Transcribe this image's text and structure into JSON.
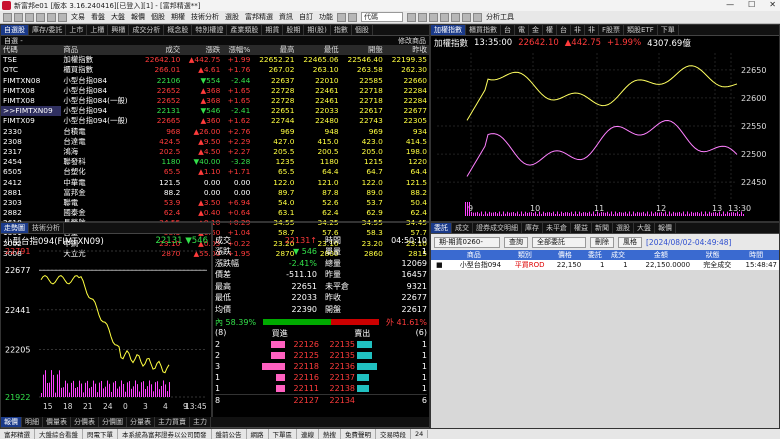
{
  "window": {
    "title": "新富邦e01 [版本 3.16.240416][已登入][1] - [富邦精選**]",
    "min": "—",
    "max": "☐",
    "close": "✕"
  },
  "menu": {
    "items": [
      "文易",
      "看盤",
      "大盤",
      "報價",
      "個股",
      "期權",
      "技術分析",
      "選股",
      "富邦精選",
      "資訊",
      "自訂",
      "功能"
    ],
    "search_value": "代碼",
    "tools": "分析工具"
  },
  "left_tabs": [
    "自選股",
    "庫存/委託",
    "上市",
    "上櫃",
    "興櫃",
    "成交分析",
    "概念股",
    "特別權證",
    "產業類股",
    "期貨",
    "股期",
    "期(股)",
    "指數",
    "個股"
  ],
  "left_sub": {
    "label": "自選 -",
    "right": "修改商品"
  },
  "quote": {
    "headers": [
      "代碼",
      "商品",
      "成交",
      "漲跌",
      "漲幅%",
      "最高",
      "最低",
      "開盤",
      "昨收"
    ],
    "rows": [
      {
        "code": "TSE",
        "name": "加權指數",
        "price": "22642.10",
        "chg": "▲442.75",
        "pct": "+1.99",
        "high": "22652.21",
        "low": "22465.06",
        "open": "22546.40",
        "prev": "22199.35",
        "c": "red"
      },
      {
        "code": "OTC",
        "name": "櫃買指數",
        "price": "266.01",
        "chg": "▲4.61",
        "pct": "+1.76",
        "high": "267.02",
        "low": "263.10",
        "open": "263.58",
        "prev": "262.30",
        "c": "red"
      },
      {
        "code": "FIMTXN08",
        "name": "小型台指084",
        "price": "22106",
        "chg": "▼554",
        "pct": "-2.44",
        "high": "22637",
        "low": "22010",
        "open": "22585",
        "prev": "22660",
        "c": "green"
      },
      {
        "code": "FIMTX08",
        "name": "小型台指084",
        "price": "22652",
        "chg": "▲368",
        "pct": "+1.65",
        "high": "22728",
        "low": "22461",
        "open": "22718",
        "prev": "22284",
        "c": "red"
      },
      {
        "code": "FIMTX08",
        "name": "小型台指084(一般)",
        "price": "22652",
        "chg": "▲368",
        "pct": "+1.65",
        "high": "22728",
        "low": "22461",
        "open": "22718",
        "prev": "22284",
        "c": "red"
      },
      {
        "code": ">>FIMTXN09",
        "name": "小型台指094",
        "price": "22131",
        "chg": "▼546",
        "pct": "-2.41",
        "high": "22651",
        "low": "22033",
        "open": "22617",
        "prev": "22677",
        "c": "green",
        "hl": true
      },
      {
        "code": "FIMTX09",
        "name": "小型台指094(一般)",
        "price": "22665",
        "chg": "▲360",
        "pct": "+1.62",
        "high": "22744",
        "low": "22480",
        "open": "22743",
        "prev": "22305",
        "c": "red"
      },
      {
        "code": "2330",
        "name": "台積電",
        "price": "968",
        "chg": "▲26.00",
        "pct": "+2.76",
        "high": "969",
        "low": "948",
        "open": "969",
        "prev": "934",
        "c": "red"
      },
      {
        "code": "2308",
        "name": "台達電",
        "price": "424.5",
        "chg": "▲9.50",
        "pct": "+2.29",
        "high": "427.0",
        "low": "415.0",
        "open": "423.0",
        "prev": "414.5",
        "c": "red"
      },
      {
        "code": "2317",
        "name": "鴻海",
        "price": "202.5",
        "chg": "▲4.50",
        "pct": "+2.27",
        "high": "205.5",
        "low": "200.5",
        "open": "205.0",
        "prev": "198.0",
        "c": "red"
      },
      {
        "code": "2454",
        "name": "聯發科",
        "price": "1180",
        "chg": "▼40.00",
        "pct": "-3.28",
        "high": "1235",
        "low": "1180",
        "open": "1215",
        "prev": "1220",
        "c": "green"
      },
      {
        "code": "6505",
        "name": "台塑化",
        "price": "65.5",
        "chg": "▲1.10",
        "pct": "+1.71",
        "high": "65.5",
        "low": "64.4",
        "open": "64.7",
        "prev": "64.4",
        "c": "red"
      },
      {
        "code": "2412",
        "name": "中華電",
        "price": "121.5",
        "chg": "0.00",
        "pct": "0.00",
        "high": "122.0",
        "low": "121.0",
        "open": "122.0",
        "prev": "121.5",
        "c": "white"
      },
      {
        "code": "2881",
        "name": "富邦金",
        "price": "88.2",
        "chg": "0.00",
        "pct": "0.00",
        "high": "89.7",
        "low": "87.8",
        "open": "89.0",
        "prev": "88.2",
        "c": "white"
      },
      {
        "code": "2303",
        "name": "聯電",
        "price": "53.9",
        "chg": "▲3.50",
        "pct": "+6.94",
        "high": "54.0",
        "low": "52.6",
        "open": "53.7",
        "prev": "50.4",
        "c": "red"
      },
      {
        "code": "2882",
        "name": "國泰金",
        "price": "62.4",
        "chg": "▲0.40",
        "pct": "+0.64",
        "high": "63.1",
        "low": "62.4",
        "open": "62.9",
        "prev": "62.4",
        "c": "red"
      },
      {
        "code": "2618",
        "name": "長榮航",
        "price": "34.55",
        "chg": "▲0.10",
        "pct": "+0.29",
        "high": "34.55",
        "low": "34.25",
        "open": "34.55",
        "prev": "34.45",
        "c": "red"
      },
      {
        "code": "1301",
        "name": "台塑",
        "price": "58.3",
        "chg": "▲0.60",
        "pct": "+1.04",
        "high": "58.7",
        "low": "57.6",
        "open": "58.3",
        "prev": "57.7",
        "c": "red"
      },
      {
        "code": "2002",
        "name": "中鋼",
        "price": "23.10",
        "chg": "▲0.05",
        "pct": "+0.22",
        "high": "23.20",
        "low": "23.10",
        "open": "23.20",
        "prev": "23.10",
        "c": "red"
      },
      {
        "code": "3008",
        "name": "大立光",
        "price": "2870",
        "chg": "▲55.00",
        "pct": "+1.95",
        "high": "2870",
        "low": "2800",
        "open": "2860",
        "prev": "2815",
        "c": "red"
      }
    ]
  },
  "right_tabs": [
    "加權指數",
    "櫃買指數",
    "台",
    "電",
    "金",
    "權",
    "台",
    "非",
    "非",
    "F股票",
    "類股ETF",
    "下單"
  ],
  "index_chart": {
    "name": "加權指數",
    "time": "13:35:00",
    "price": "22642.10",
    "flag": "s",
    "chg": "▲442.75",
    "pct": "+1.99%",
    "amount": "4307.69億",
    "y_ticks": [
      "22650",
      "22600",
      "22550",
      "22500",
      "22450"
    ],
    "x_ticks": [
      "9",
      "10",
      "11",
      "12",
      "13",
      "13:30"
    ],
    "ylim": [
      22420,
      22680
    ]
  },
  "detail": {
    "tab1": "走勢圖",
    "tab2": "技術分析",
    "title": "小型台指094(FIMTXN09)",
    "last": "22131",
    "chg": "▼546",
    "y_ticks": [
      "22791",
      "22677",
      "22441",
      "22205",
      "21922"
    ],
    "x_ticks": [
      "15",
      "18",
      "21",
      "24",
      "0",
      "3",
      "4",
      "9"
    ],
    "ylim": [
      21922,
      22791
    ],
    "stats_left": [
      [
        "成交",
        "22131↑",
        "red"
      ],
      [
        "漲跌",
        "▼ 546",
        "green"
      ],
      [
        "漲跌幅",
        "-2.41%",
        "green"
      ],
      [
        "價差",
        "-511.10",
        "white"
      ],
      [
        "最高",
        "22651",
        "white"
      ],
      [
        "最低",
        "22033",
        "white"
      ],
      [
        "均價",
        "22390",
        "white"
      ]
    ],
    "stats_right": [
      [
        "時間",
        "04:50:10",
        "white"
      ],
      [
        "單量",
        "1",
        "white"
      ],
      [
        "總量",
        "12069",
        "white"
      ],
      [
        "昨量",
        "16457",
        "white"
      ],
      [
        "未平倉",
        "9321",
        "white"
      ],
      [
        "昨收",
        "22677",
        "white"
      ],
      [
        "開盤",
        "22617",
        "white"
      ]
    ],
    "inner": "內 58.39%",
    "outer": "外 41.61%",
    "inner_pct": 58.39,
    "book_header": [
      "(8)",
      "買進",
      "賣出",
      "(6)"
    ],
    "bids": [
      {
        "qty": "2",
        "price": "22126",
        "bar": 0.25
      },
      {
        "qty": "2",
        "price": "22125",
        "bar": 0.25
      },
      {
        "qty": "3",
        "price": "22118",
        "bar": 0.4
      },
      {
        "qty": "1",
        "price": "22116",
        "bar": 0.15
      },
      {
        "qty": "1",
        "price": "22111",
        "bar": 0.15
      }
    ],
    "asks": [
      {
        "qty": "1",
        "price": "22135",
        "bar": 0.25
      },
      {
        "qty": "1",
        "price": "22135",
        "bar": 0.25
      },
      {
        "qty": "1",
        "price": "22136",
        "bar": 0.35
      },
      {
        "qty": "1",
        "price": "22137",
        "bar": 0.2
      },
      {
        "qty": "1",
        "price": "22138",
        "bar": 0.2
      }
    ],
    "bid_total": "8",
    "bid_total_price": "22127",
    "ask_total_price": "22134",
    "ask_total": "6",
    "bottom_tabs": [
      "報價",
      "明細",
      "價量表",
      "分價表",
      "分價圖",
      "分量表",
      "主力買賣",
      "主力"
    ],
    "bottom_time": "13:45"
  },
  "order": {
    "tabs": [
      "委託",
      "成交",
      "證券成交明細",
      "庫存",
      "未平倉",
      "權益",
      "新聞",
      "選股",
      "大盤",
      "報價"
    ],
    "account": "期-期貨0260-",
    "query_btn": "查詢",
    "filter": "全部委託",
    "delete_btn": "刪除",
    "risk_btn": "風格",
    "timestamp": "[2024/08/02-04:49:48]",
    "headers": [
      "",
      "商品",
      "類別",
      "價格",
      "委託",
      "成交",
      "金額",
      "狀態",
      "時間"
    ],
    "rows": [
      {
        "sel": "■",
        "name": "小型台指094",
        "type": "平買ROD",
        "price": "22,150",
        "qty": "1",
        "filled": "1",
        "amount": "22,150.0000",
        "status": "完全成交",
        "time": "15:48:47"
      }
    ]
  },
  "status": {
    "items": [
      "富邦精選",
      "大盤綜合看盤",
      "閃電下單",
      "本系統為富邦證券以公司開發",
      "盤前公告",
      "網路",
      "下單區",
      "連線",
      "熱搜",
      "免費聲明",
      "交易時段",
      "24"
    ]
  },
  "colors": {
    "tse": "#ffff40",
    "avg": "#ff80ff",
    "accent": "#1a3a8a"
  }
}
